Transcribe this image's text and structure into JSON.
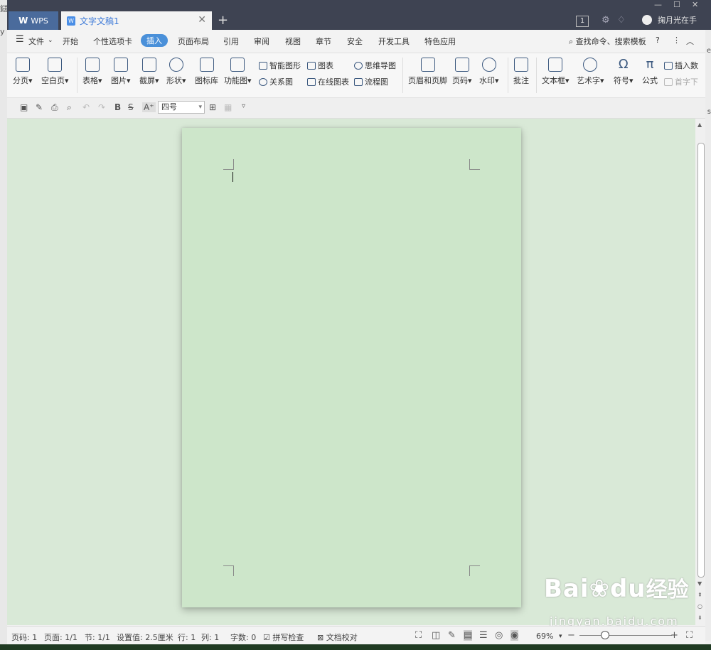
{
  "edge": {
    "left_chars": [
      "鎹",
      "y"
    ],
    "right_chars": [
      "e",
      "s"
    ]
  },
  "titlebar": {
    "app_tab": "WPS",
    "doc_tab": "文字文稿1",
    "new_tab": "+",
    "badge": "1",
    "username": "掬月光在手"
  },
  "menu": {
    "items": [
      "文件",
      "开始",
      "个性选项卡",
      "插入",
      "页面布局",
      "引用",
      "审阅",
      "视图",
      "章节",
      "安全",
      "开发工具",
      "特色应用"
    ],
    "search": "查找命令、搜索模板",
    "help": "?"
  },
  "ribbon": {
    "fenye": "分页",
    "kongbai": "空白页",
    "biaoge": "表格",
    "tupian": "图片",
    "jieping": "截屏",
    "xingzhuang": "形状",
    "tubiaoku": "图标库",
    "gongnengtu": "功能图",
    "zhineng": "智能图形",
    "tubiao": "图表",
    "siwei": "思维导图",
    "guanxi": "关系图",
    "zaixian": "在线图表",
    "liucheng": "流程图",
    "yemei": "页眉和页脚",
    "yema": "页码",
    "shuiyin": "水印",
    "pizhu": "批注",
    "wenbenkuang": "文本框",
    "yishuzi": "艺术字",
    "fuhao": "符号",
    "gongshi": "公式",
    "charu": "插入数",
    "shouzi": "首字下"
  },
  "format": {
    "font_size": "四号",
    "bold": "B"
  },
  "status": {
    "page": "页码: 1",
    "pages": "页面: 1/1",
    "section": "节: 1/1",
    "setting": "设置值: 2.5厘米",
    "row": "行: 1",
    "col": "列: 1",
    "words": "字数: 0",
    "spell": "拼写检查",
    "proof": "文档校对",
    "zoom": "69%"
  },
  "watermark": {
    "brand": "Bai",
    "brand2": "du",
    "cn": "经验",
    "url": "jingyan.baidu.com"
  }
}
